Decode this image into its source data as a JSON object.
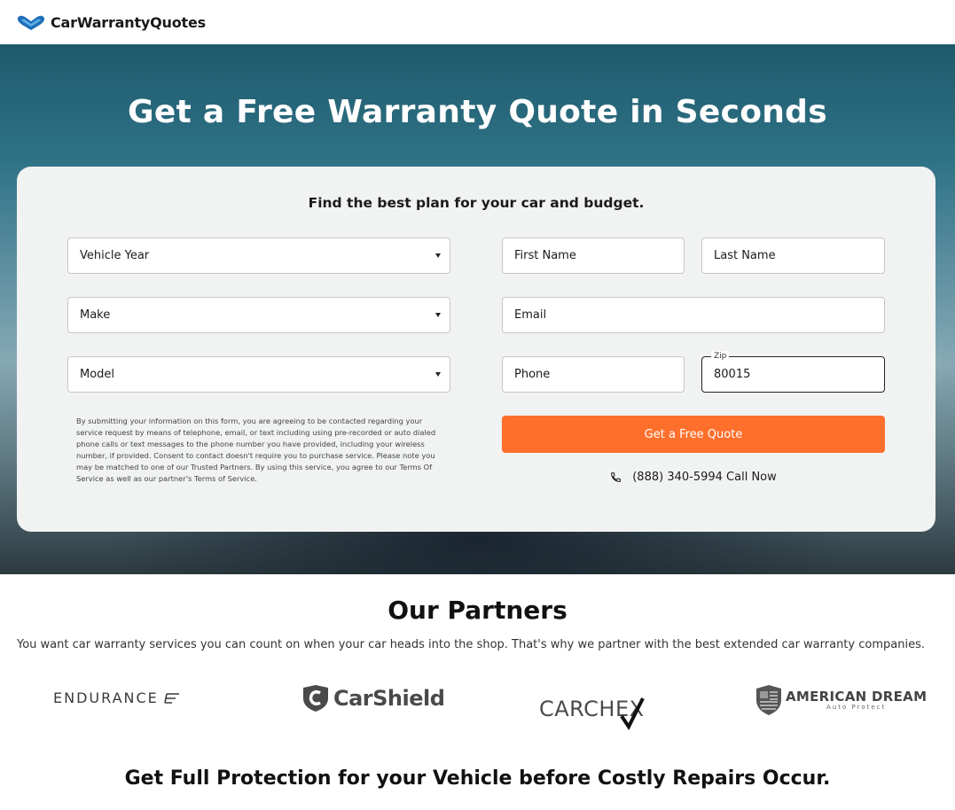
{
  "header": {
    "brand": "CarWarrantyQuotes",
    "logo_icon": "double-heart-logo-icon",
    "brand_color": "#1e6fb8"
  },
  "hero": {
    "title": "Get a Free Warranty Quote in Seconds"
  },
  "form": {
    "subtitle": "Find the best plan for your car and budget.",
    "vehicle_year": {
      "value": "Vehicle Year"
    },
    "make": {
      "value": "Make"
    },
    "model": {
      "value": "Model"
    },
    "first_name": {
      "placeholder": "First Name"
    },
    "last_name": {
      "placeholder": "Last Name"
    },
    "email": {
      "placeholder": "Email"
    },
    "phone": {
      "placeholder": "Phone"
    },
    "zip": {
      "label": "Zip",
      "value": "80015"
    },
    "legal": "By submitting your information on this form, you are agreeing to be contacted regarding your service request by means of telephone, email, or text including using pre-recorded or auto dialed phone calls or text messages to the phone number you have provided, including your wireless number, if provided. Consent to contact doesn't require you to purchase service. Please note you may be matched to one of our Trusted Partners. By using this service, you agree to our Terms Of Service as well as our partner's Terms of Service.",
    "submit_label": "Get a Free Quote",
    "call_text": "(888) 340-5994 Call Now",
    "accent_color": "#ff6f2c"
  },
  "partners": {
    "title": "Our Partners",
    "description": "You want car warranty services you can count on when your car heads into the shop. That's why we partner with the best extended car warranty companies.",
    "logos": {
      "endurance": "ENDURANCE",
      "carshield": "CarShield",
      "carchex": "CARCHEX",
      "american_dream": "AMERICAN DREAM",
      "american_dream_tag": "Auto Protect"
    }
  },
  "protection": {
    "title": "Get Full Protection for your Vehicle before Costly Repairs Occur."
  }
}
